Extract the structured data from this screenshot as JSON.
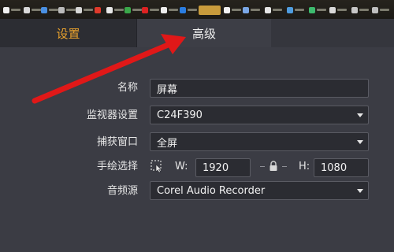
{
  "tabs": {
    "settings": "设置",
    "advanced": "高级"
  },
  "form": {
    "name_label": "名称",
    "name_value": "屏幕",
    "monitor_label": "监视器设置",
    "monitor_value": "C24F390",
    "capture_window_label": "捕获窗口",
    "capture_window_value": "全屏",
    "freehand_label": "手绘选择",
    "width_label": "W:",
    "width_value": "1920",
    "height_label": "H:",
    "height_value": "1080",
    "audio_source_label": "音频源",
    "audio_source_value": "Corel Audio Recorder"
  },
  "colors": {
    "active_tab_text": "#e8a12d",
    "annotation_arrow": "#e01818"
  },
  "icons": {
    "freehand": "cursor-select-icon",
    "aspect_lock": "lock-icon",
    "dropdown": "chevron-down-icon"
  }
}
